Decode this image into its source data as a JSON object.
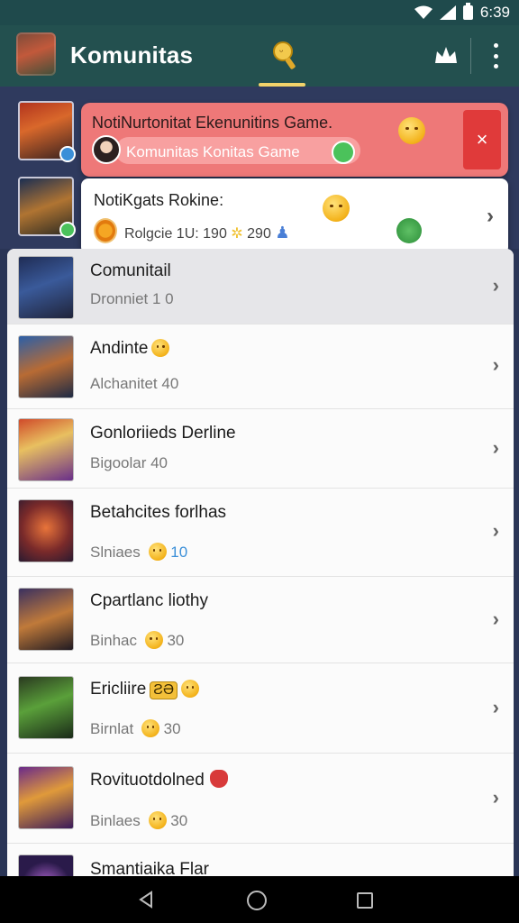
{
  "status": {
    "time": "6:39"
  },
  "app_bar": {
    "title": "Komunitas"
  },
  "notification_1": {
    "title": "NotiNurtonitat Ekenunitins Game.",
    "pill_text": "Komunitas Konitas Game",
    "close_label": "×"
  },
  "notification_2": {
    "title": "NotiKgats Rokine:",
    "meta_a": "Rolgcie 1U: 190",
    "meta_b": "290"
  },
  "list": [
    {
      "title": "Comunitail",
      "subtitle": "Dronniet 1 0"
    },
    {
      "title": "Andinte",
      "subtitle": "Alchanitet 40"
    },
    {
      "title": "Gonloriieds Derline",
      "subtitle": "Bigoolar 40"
    },
    {
      "title": "Betahcites forlhas",
      "subtitle": "Slniaes",
      "count": "10"
    },
    {
      "title": "Cpartlanc liothy",
      "subtitle": "Binhac",
      "count": "30"
    },
    {
      "title": "Ericliire",
      "tag": "ƧƏ",
      "subtitle": "Birnlat",
      "count": "30"
    },
    {
      "title": "Rovituotdolned",
      "subtitle": "Binlaes",
      "count": "30"
    },
    {
      "title": "Smantiaika Flar"
    }
  ],
  "colors": {
    "app_bar": "#23504f",
    "accent_underline": "#f2d36a",
    "notification_red": "#ee7878",
    "close_red": "#e03a3a"
  }
}
